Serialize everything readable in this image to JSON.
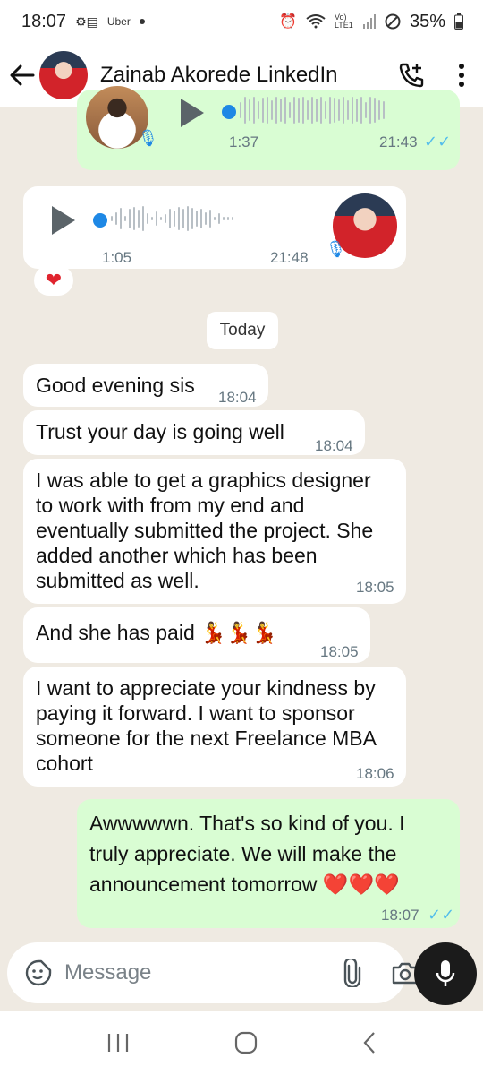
{
  "status_bar": {
    "time": "18:07",
    "carrier_label": "Uber",
    "lte_label": "Vo) LTE1",
    "battery": "35%"
  },
  "header": {
    "contact_name": "Zainab Akorede LinkedIn"
  },
  "messages": {
    "voice_out": {
      "duration": "1:37",
      "time": "21:43",
      "ticks": "✓✓"
    },
    "voice_in": {
      "duration": "1:05",
      "time": "21:48",
      "reaction": "❤"
    },
    "date_divider": "Today",
    "in_1": {
      "text": "Good evening sis",
      "time": "18:04"
    },
    "in_2": {
      "text": "Trust your day is going well",
      "time": "18:04"
    },
    "in_3": {
      "text": "I was able to get a graphics designer to work with from my end and eventually submitted the project. She added another which has been submitted as well.",
      "time": "18:05"
    },
    "in_4": {
      "text": "And she has paid 💃💃💃",
      "time": "18:05"
    },
    "in_5": {
      "text": "I want to appreciate your kindness by paying it forward. I want to sponsor someone for the next Freelance MBA cohort",
      "time": "18:06"
    },
    "out_1": {
      "text": "Awwwwwn. That's so kind of you. I truly appreciate. We will make the announcement tomorrow ❤️❤️❤️",
      "time": "18:07",
      "ticks": "✓✓"
    }
  },
  "composer": {
    "placeholder": "Message"
  },
  "colors": {
    "chat_background": "#efeae2",
    "outgoing_bubble": "#d9fdd3",
    "incoming_bubble": "#ffffff",
    "read_ticks": "#53bdeb",
    "accent_blue": "#1e88e5"
  }
}
